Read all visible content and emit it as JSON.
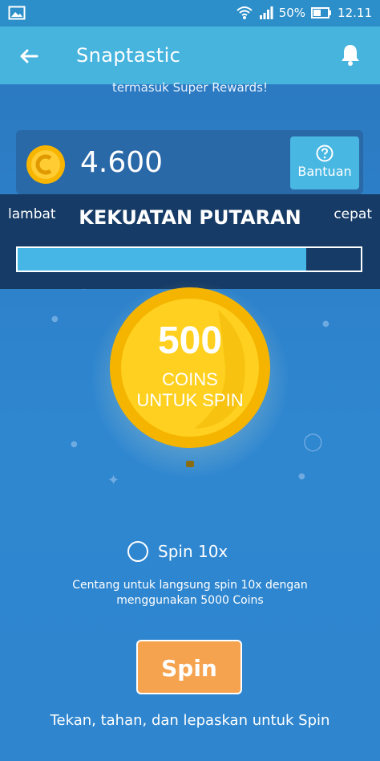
{
  "status_bar": {
    "battery_percent": "50%",
    "time": "12.11",
    "icons": [
      "gallery-icon",
      "wifi-icon",
      "signal-icon",
      "battery-icon"
    ]
  },
  "app_bar": {
    "title": "Snaptastic",
    "icons": [
      "back-arrow-icon",
      "bell-icon"
    ]
  },
  "main": {
    "subtitle": "termasuk Super Rewards!",
    "balance": "4.600",
    "help_label": "Bantuan"
  },
  "power": {
    "title": "KEKUATAN PUTARAN",
    "slow_label": "lambat",
    "fast_label": "cepat",
    "level": 0.84
  },
  "coin": {
    "value": "500",
    "label_line1": "COINS",
    "label_line2": "UNTUK SPIN"
  },
  "options": {
    "spin10_label": "Spin 10x",
    "hint_line1": "Centang untuk langsung spin 10x dengan",
    "hint_line2": "menggunakan 5000 Coins"
  },
  "actions": {
    "spin_label": "Spin",
    "instruction": "Tekan, tahan, dan lepaskan untuk Spin"
  },
  "colors": {
    "app_bar": "#47b4de",
    "background": "#2f86cf",
    "power_panel": "#153b66",
    "power_fill": "#46b6e6",
    "spin_button": "#f5a34f",
    "coin": "#f4c300"
  }
}
